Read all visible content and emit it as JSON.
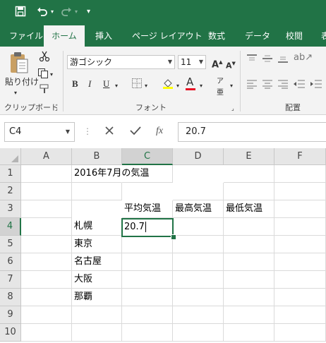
{
  "ribbon_tabs": [
    "ファイル",
    "ホーム",
    "挿入",
    "ページ レイアウト",
    "数式",
    "データ",
    "校閲",
    "表"
  ],
  "ribbon": {
    "clipboard": {
      "paste_label": "貼り付け",
      "group_label": "クリップボード"
    },
    "font": {
      "font_name": "游ゴシック",
      "font_size": "11",
      "bold": "B",
      "italic": "I",
      "underline": "U",
      "font_color_letter": "A",
      "group_label": "フォント",
      "grow_font": "A",
      "shrink_font": "A"
    },
    "alignment": {
      "group_label": "配置"
    }
  },
  "formula_bar": {
    "name_box": "C4",
    "fx": "fx",
    "value": "20.7"
  },
  "grid": {
    "columns": [
      "A",
      "B",
      "C",
      "D",
      "E",
      "F"
    ],
    "rows": [
      "1",
      "2",
      "3",
      "4",
      "5",
      "6",
      "7",
      "8",
      "9",
      "10"
    ],
    "cells": {
      "B1": "2016年7月の気温",
      "C3": "平均気温",
      "D3": "最高気温",
      "E3": "最低気温",
      "B4": "札幌",
      "C4": "20.7",
      "B5": "東京",
      "B6": "名古屋",
      "B7": "大阪",
      "B8": "那覇"
    }
  },
  "colors": {
    "accent": "#217346",
    "font_color_underline": "#e81123"
  }
}
